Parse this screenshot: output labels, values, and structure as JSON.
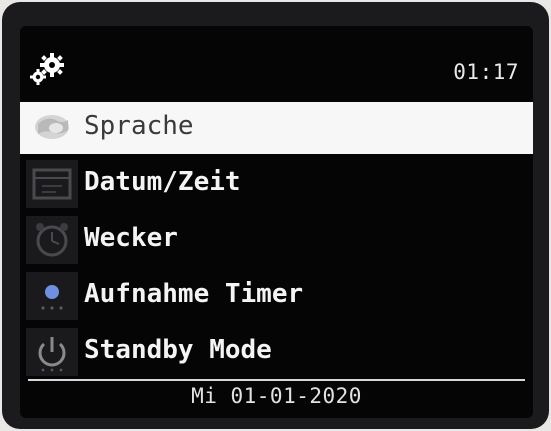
{
  "header": {
    "settings_icon": "gear-icon",
    "time": "01:17"
  },
  "menu": {
    "items": [
      {
        "label": "Sprache",
        "icon": "globe-icon",
        "selected": true
      },
      {
        "label": "Datum/Zeit",
        "icon": "calendar-icon",
        "selected": false
      },
      {
        "label": "Wecker",
        "icon": "alarm-clock-icon",
        "selected": false
      },
      {
        "label": "Aufnahme Timer",
        "icon": "record-icon",
        "selected": false
      },
      {
        "label": "Standby Mode",
        "icon": "power-icon",
        "selected": false
      }
    ]
  },
  "footer": {
    "date": "Mi 01-01-2020"
  },
  "colors": {
    "background": "#050506",
    "selected_background": "#f7f7f7",
    "text": "#f4f4f4",
    "record_dot": "#6f8fe0"
  }
}
